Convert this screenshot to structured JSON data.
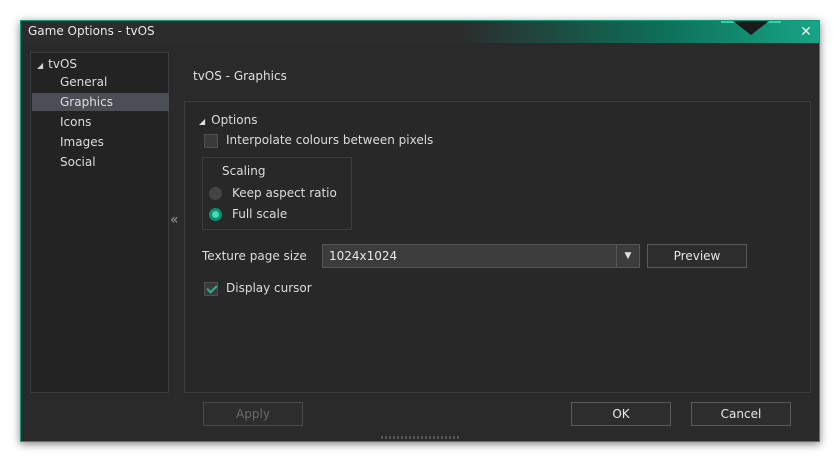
{
  "window": {
    "title": "Game Options - tvOS",
    "accent": "#0f9a7a"
  },
  "sidebar": {
    "root": "tvOS",
    "items": [
      {
        "label": "General",
        "selected": false
      },
      {
        "label": "Graphics",
        "selected": true
      },
      {
        "label": "Icons",
        "selected": false
      },
      {
        "label": "Images",
        "selected": false
      },
      {
        "label": "Social",
        "selected": false
      }
    ]
  },
  "main": {
    "section_title": "tvOS - Graphics",
    "options_header": "Options",
    "interpolate": {
      "label": "Interpolate colours between pixels",
      "checked": false
    },
    "scaling": {
      "title": "Scaling",
      "options": [
        {
          "label": "Keep aspect ratio",
          "checked": false
        },
        {
          "label": "Full scale",
          "checked": true
        }
      ]
    },
    "texture": {
      "label": "Texture page size",
      "value": "1024x1024"
    },
    "preview_label": "Preview",
    "display_cursor": {
      "label": "Display cursor",
      "checked": true
    }
  },
  "footer": {
    "apply_label": "Apply",
    "ok_label": "OK",
    "cancel_label": "Cancel"
  },
  "icons": {
    "collapse": "double-chevron-left-icon",
    "close": "close-icon"
  }
}
